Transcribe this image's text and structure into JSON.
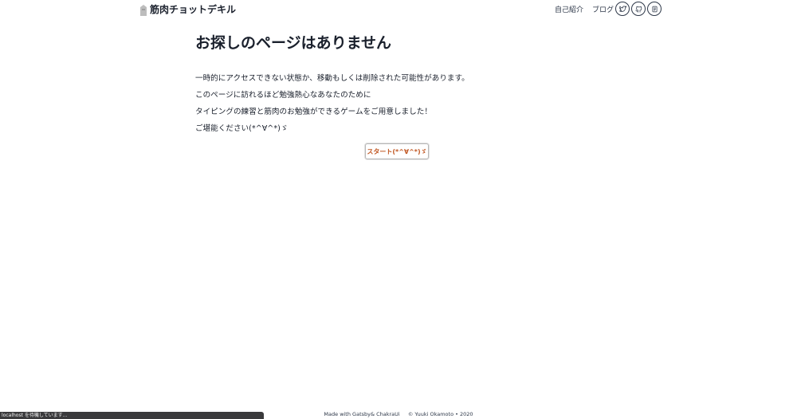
{
  "header": {
    "logo_text": "筋肉チョットデキル",
    "nav": {
      "about": "自己紹介",
      "blog": "ブログ"
    },
    "icons": [
      "twitter-icon",
      "github-icon",
      "note-icon"
    ]
  },
  "main": {
    "title": "お探しのページはありません",
    "messages": [
      "一時的にアクセスできない状態か、移動もしくは削除された可能性があります。",
      "このページに訪れるほど勉強熱心なあなたのために",
      "タイピングの練習と筋肉のお勉強ができるゲームをご用意しました！",
      "ご堪能ください(*^∀^*)ゞ"
    ],
    "start_button": "スタート(*^∀^*)ゞ"
  },
  "footer": {
    "made_with": "Made with Gatsby& ChakraUi",
    "copyright": "© Yuuki Okamoto • 2020"
  },
  "status_bar": {
    "text": "localhost を待機しています..."
  },
  "colors": {
    "accent": "#c05621",
    "text": "#1a202c",
    "status_bar_bg": "#3a3a3c"
  }
}
